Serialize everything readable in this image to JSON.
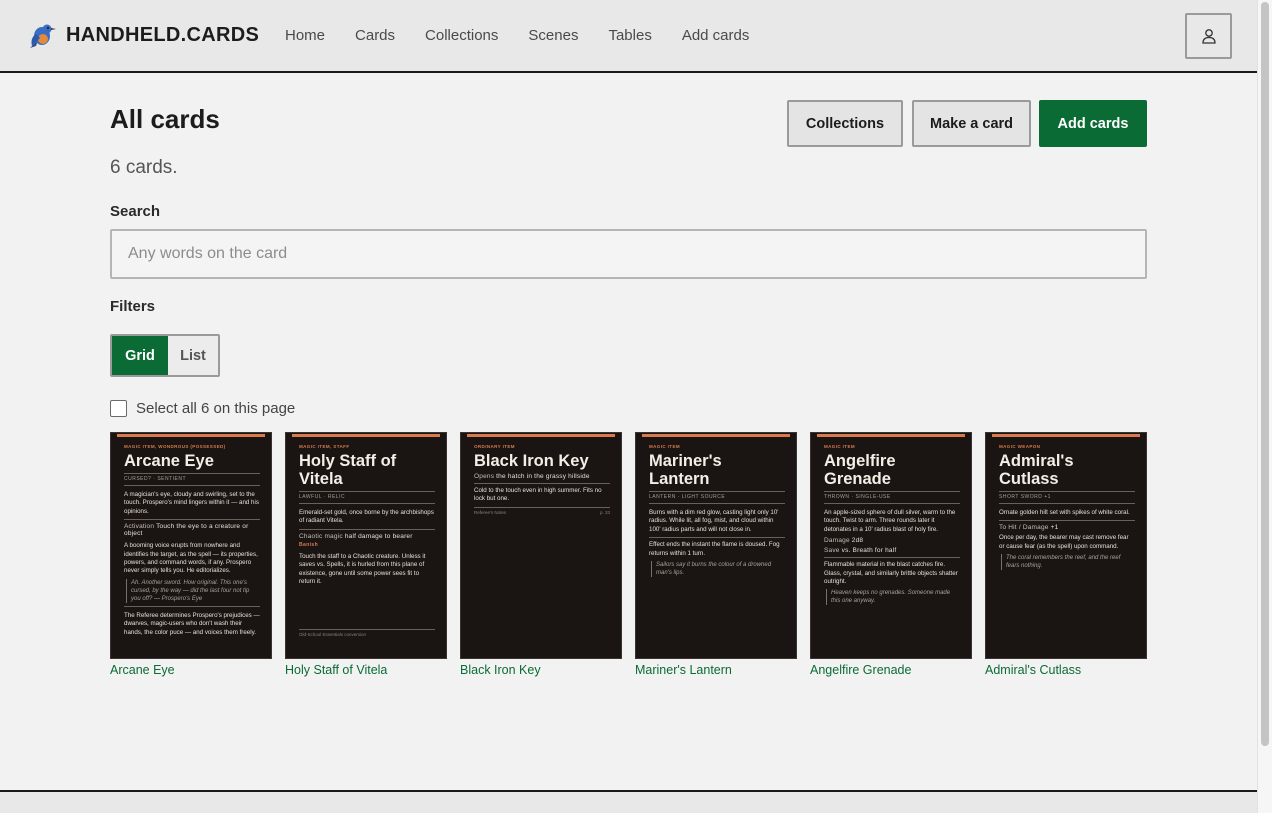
{
  "brand": "HANDHELD.CARDS",
  "nav": [
    "Home",
    "Cards",
    "Collections",
    "Scenes",
    "Tables",
    "Add cards"
  ],
  "page": {
    "title": "All cards",
    "count": "6 cards.",
    "buttons": {
      "collections": "Collections",
      "make": "Make a card",
      "add": "Add cards"
    },
    "search": {
      "label": "Search",
      "placeholder": "Any words on the card"
    },
    "filters_label": "Filters",
    "view_toggle": {
      "grid": "Grid",
      "list": "List",
      "selected": "Grid"
    },
    "select_all": "Select all 6 on this page"
  },
  "cards": [
    {
      "caption": "Arcane Eye",
      "category": "Magic item, wondrous (possessed)",
      "title": "Arcane Eye",
      "tags": "Cursed? · Sentient",
      "p1": "A magician's eye, cloudy and swirling, set to the touch. Prospero's mind lingers within it — and his opinions.",
      "head1": "Activation",
      "head1_text": "Touch the eye to a creature or object",
      "p2": "A booming voice erupts from nowhere and identifies the target, as the spell — its properties, powers, and command words, if any. Prospero never simply tells you. He editorializes.",
      "quote": "Ah. Another sword. How original. This one's cursed, by the way — did the last four not tip you off? — Prospero's Eye",
      "p3": "The Referee determines Prospero's prejudices — dwarves, magic-users who don't wash their hands, the color puce — and voices them freely."
    },
    {
      "caption": "Holy Staff of Vitela",
      "category": "Magic item, staff",
      "title": "Holy Staff of Vitela",
      "tags": "Lawful · Relic",
      "p1": "Emerald-set gold, once borne by the archbishops of radiant Vitela.",
      "head1": "Chaotic magic",
      "head1_text": "half damage to bearer",
      "red": "Banish",
      "p2": "Touch the staff to a Chaotic creature. Unless it saves vs. Spells, it is hurled from this plane of existence, gone until some power sees fit to return it.",
      "foot": "Old-School Essentials conversion"
    },
    {
      "caption": "Black Iron Key",
      "category": "Ordinary item",
      "title": "Black Iron Key",
      "head1": "Opens",
      "head1_text": "the hatch in the grassy hillside",
      "p1": "Cold to the touch even in high summer. Fits no lock but one.",
      "foot_left": "Referee's Notes",
      "foot_right": "p. 33"
    },
    {
      "caption": "Mariner's Lantern",
      "category": "Magic item",
      "title": "Mariner's Lantern",
      "tags": "Lantern · Light source",
      "p1": "Burns with a dim red glow, casting light only 10' radius. While lit, all fog, mist, and cloud within 100' radius parts and will not close in.",
      "p2": "Effect ends the instant the flame is doused. Fog returns within 1 turn.",
      "quote": "Sailors say it burns the colour of a drowned man's lips."
    },
    {
      "caption": "Angelfire Grenade",
      "category": "Magic item",
      "title": "Angelfire Grenade",
      "tags": "Thrown · Single-use",
      "p1": "An apple-sized sphere of dull silver, warm to the touch. Twist to arm. Three rounds later it detonates in a 10' radius blast of holy fire.",
      "head1": "Damage",
      "head1_text": "2d8",
      "head2": "Save",
      "head2_text": "vs. Breath for half",
      "p2": "Flammable material in the blast catches fire. Glass, crystal, and similarly brittle objects shatter outright.",
      "quote": "Heaven keeps no grenades. Someone made this one anyway."
    },
    {
      "caption": "Admiral's Cutlass",
      "category": "Magic weapon",
      "title": "Admiral's Cutlass",
      "tags": "Short sword +1",
      "p1": "Ornate golden hilt set with spikes of white coral.",
      "head1": "To Hit / Damage",
      "head1_text": "+1",
      "p2": "Once per day, the bearer may cast remove fear or cause fear (as the spell) upon command.",
      "quote": "The coral remembers the reef, and the reef fears nothing."
    }
  ],
  "colors": {
    "accent": "#0b6b34",
    "card_bg": "#1a1512",
    "card_accent": "#d87a4f"
  },
  "icons": {
    "logo": "bluebird-logo-icon",
    "user": "user-icon"
  }
}
